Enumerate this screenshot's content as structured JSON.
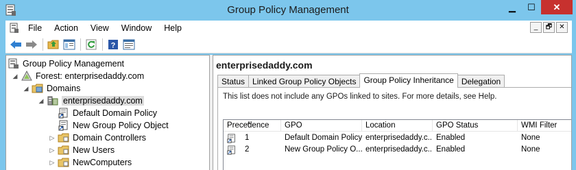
{
  "window": {
    "title": "Group Policy Management",
    "buttons": {
      "minimize": "▁",
      "maximize": "☐",
      "close": "✕"
    }
  },
  "menu": {
    "items": [
      "File",
      "Action",
      "View",
      "Window",
      "Help"
    ],
    "mdi": {
      "minimize": "_",
      "restore": "🗗",
      "close": "✕"
    }
  },
  "toolbar": {
    "buttons": [
      "back-icon",
      "forward-icon",
      "up-folder-icon",
      "show-hide-tree-icon",
      "refresh-icon",
      "help-icon",
      "properties-icon"
    ]
  },
  "tree": {
    "items": [
      {
        "label": "Group Policy Management",
        "expander": "",
        "icon": "gpm-icon"
      },
      {
        "label": "Forest: enterprisedaddy.com",
        "expander": "◢",
        "icon": "forest-icon"
      },
      {
        "label": "Domains",
        "expander": "◢",
        "icon": "domains-folder-icon"
      },
      {
        "label": "enterprisedaddy.com",
        "expander": "◢",
        "icon": "domain-icon"
      },
      {
        "label": "Default Domain Policy",
        "expander": "",
        "icon": "gpo-link-icon"
      },
      {
        "label": "New Group Policy Object",
        "expander": "",
        "icon": "gpo-link-icon"
      },
      {
        "label": "Domain Controllers",
        "expander": "▷",
        "icon": "ou-icon"
      },
      {
        "label": "New Users",
        "expander": "▷",
        "icon": "ou-icon"
      },
      {
        "label": "NewComputers",
        "expander": "▷",
        "icon": "ou-icon"
      }
    ]
  },
  "details": {
    "title": "enterprisedaddy.com",
    "tabs": [
      "Status",
      "Linked Group Policy Objects",
      "Group Policy Inheritance",
      "Delegation"
    ],
    "active_tab": "Group Policy Inheritance",
    "info": "This list does not include any GPOs linked to sites. For more details, see Help.",
    "columns": [
      "Precedence",
      "GPO",
      "Location",
      "GPO Status",
      "WMI Filter"
    ],
    "rows": [
      {
        "precedence": "1",
        "gpo": "Default Domain Policy",
        "location": "enterprisedaddy.c...",
        "status": "Enabled",
        "wmi": "None"
      },
      {
        "precedence": "2",
        "gpo": "New Group Policy O...",
        "location": "enterprisedaddy.c...",
        "status": "Enabled",
        "wmi": "None"
      }
    ]
  }
}
